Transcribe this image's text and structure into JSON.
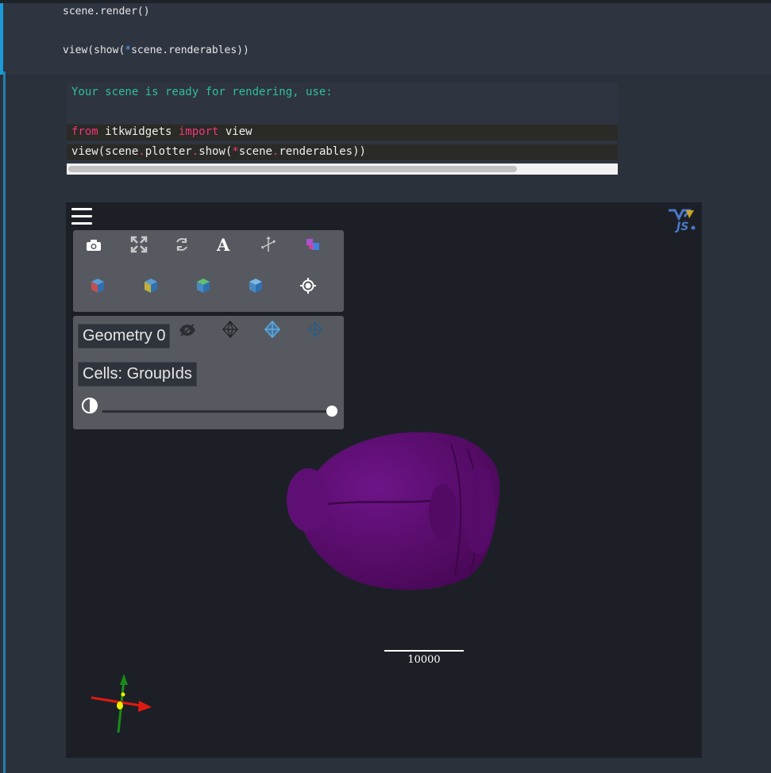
{
  "notebook": {
    "input_lines": {
      "line1": "scene.render()",
      "line2_pre": "view(show(",
      "line2_star": "*",
      "line2_post": "scene.renderables))"
    },
    "output": {
      "message": "Your scene is ready for rendering, use:",
      "import_from": "from",
      "import_module": " itkwidgets ",
      "import_kw": "import",
      "import_name": " view",
      "call_a": "view(scene",
      "call_dot1": ".",
      "call_b": "plotter",
      "call_dot2": ".",
      "call_c": "show(",
      "call_star": "*",
      "call_d": "scene",
      "call_dot3": ".",
      "call_e": "renderables))"
    }
  },
  "viewer": {
    "geometry_label": "Geometry 0",
    "color_by_label": "Cells: GroupIds",
    "opacity_value": 1.0,
    "scale_bar_label": "10000",
    "logo_text": "JS",
    "toolbar_icons": [
      "camera-icon",
      "fullscreen-icon",
      "rotate-icon",
      "annotations-icon",
      "axes-icon",
      "interpolation-icon"
    ],
    "view_icons": [
      "view-x-icon",
      "view-y-icon",
      "view-z-icon",
      "reset-view-icon",
      "recenter-icon"
    ],
    "representation_icons": [
      "visibility-icon",
      "points-icon",
      "surface-icon",
      "wireframe-icon"
    ],
    "colors": {
      "brain": "#5a0a6e",
      "axis_x": "#e01a10",
      "axis_y": "#1a8a1a",
      "axis_center": "#f0f000"
    }
  }
}
